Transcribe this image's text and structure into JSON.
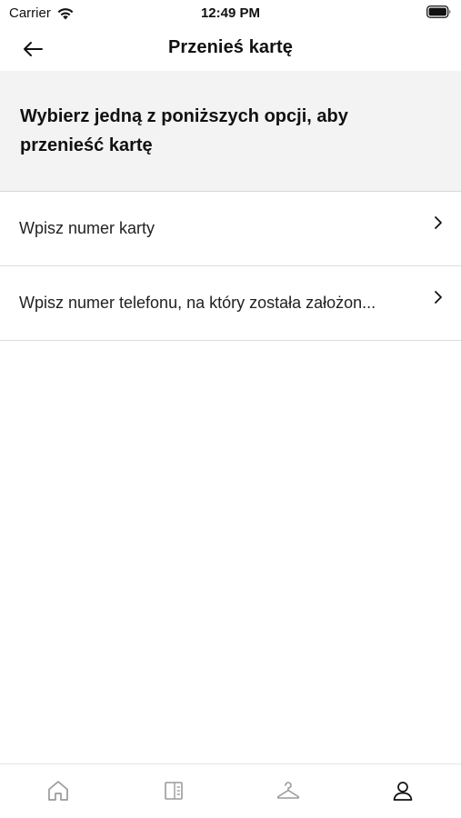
{
  "status_bar": {
    "carrier": "Carrier",
    "time": "12:49 PM"
  },
  "nav": {
    "title": "Przenieś kartę",
    "back_icon": "arrow-left-icon"
  },
  "header": {
    "text": "Wybierz jedną z poniższych opcji, aby przenieść kartę"
  },
  "options": [
    {
      "label": "Wpisz numer karty",
      "icon": "chevron-right-icon"
    },
    {
      "label": "Wpisz numer telefonu, na który została założon...",
      "icon": "chevron-right-icon"
    }
  ],
  "tab_bar": {
    "tabs": [
      {
        "icon": "home-icon",
        "active": false
      },
      {
        "icon": "catalog-icon",
        "active": false
      },
      {
        "icon": "hanger-icon",
        "active": false
      },
      {
        "icon": "profile-icon",
        "active": true
      }
    ]
  },
  "colors": {
    "header_background": "#f3f3f3",
    "active_icon": "#111111",
    "inactive_icon": "#9a9a9a"
  }
}
